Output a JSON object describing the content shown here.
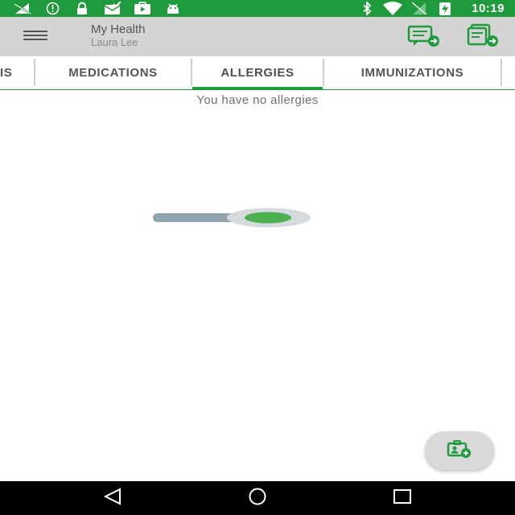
{
  "status_bar": {
    "time": "10:19",
    "left_icons": [
      "no-signal-icon",
      "info-icon",
      "lock-icon",
      "mail-check-icon",
      "play-icon",
      "android-icon"
    ],
    "right_icons": [
      "bluetooth-icon",
      "wifi-icon",
      "no-sim-icon",
      "battery-charging-icon"
    ],
    "background": "#1f9a3c"
  },
  "app_bar": {
    "title": "My Health",
    "subtitle": "Laura Lee",
    "background": "#d4d4d4",
    "actions": [
      "message-forward-icon",
      "records-forward-icon"
    ]
  },
  "tabs": {
    "items": [
      {
        "label": "IS"
      },
      {
        "label": "MEDICATIONS"
      },
      {
        "label": "ALLERGIES",
        "selected": true
      },
      {
        "label": "IMMUNIZATIONS"
      }
    ],
    "accent": "#1f9a3c"
  },
  "content": {
    "empty_message": "You have no allergies",
    "toggle": {
      "state": "on",
      "track_color": "#90a4ae",
      "thumb_color": "#4caf50"
    }
  },
  "fab": {
    "icon": "add-record-icon"
  },
  "nav_bar": {
    "buttons": [
      "back-icon",
      "home-icon",
      "recents-icon"
    ]
  }
}
